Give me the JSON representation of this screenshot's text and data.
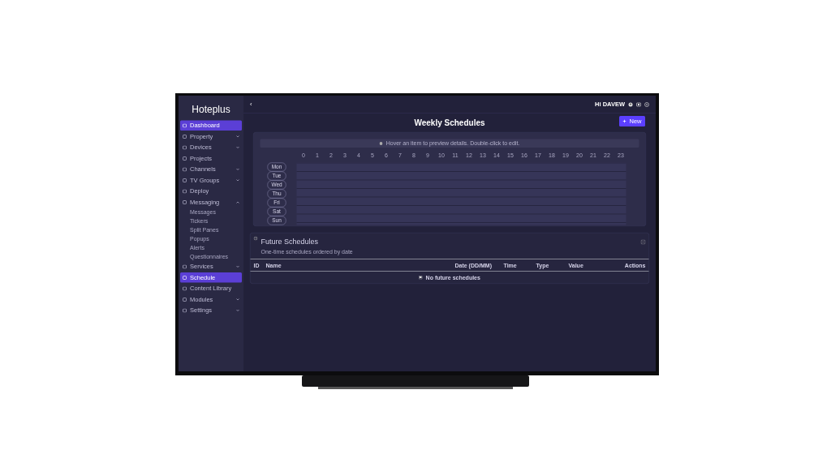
{
  "logo": "Hoteplus",
  "sidebar": {
    "items": [
      {
        "label": "Dashboard",
        "selected": true
      },
      {
        "label": "Property",
        "selected": false,
        "expanded": false
      },
      {
        "label": "Devices",
        "selected": false,
        "expanded": false
      },
      {
        "label": "Projects",
        "selected": false
      },
      {
        "label": "Channels",
        "selected": false,
        "expanded": false
      },
      {
        "label": "TV Groups",
        "selected": false,
        "expanded": false
      },
      {
        "label": "Deploy",
        "selected": false
      },
      {
        "label": "Messaging",
        "selected": false,
        "expanded": true,
        "children": [
          {
            "label": "Messages"
          },
          {
            "label": "Tickers"
          },
          {
            "label": "Split Panes"
          },
          {
            "label": "Popups"
          },
          {
            "label": "Alerts"
          },
          {
            "label": "Questionnaires"
          }
        ]
      },
      {
        "label": "Services",
        "selected": false,
        "expanded": false
      },
      {
        "label": "Schedule",
        "selected": true
      },
      {
        "label": "Content Library",
        "selected": false
      },
      {
        "label": "Modules",
        "selected": false,
        "expanded": false
      },
      {
        "label": "Settings",
        "selected": false,
        "expanded": false
      }
    ]
  },
  "topbar": {
    "back": "‹",
    "greeting": "Hi DAVEW"
  },
  "page": {
    "title": "Weekly Schedules",
    "new_button": "New"
  },
  "weekly": {
    "hint": "Hover an item to preview details. Double-click to edit.",
    "hours": [
      "0",
      "1",
      "2",
      "3",
      "4",
      "5",
      "6",
      "7",
      "8",
      "9",
      "10",
      "11",
      "12",
      "13",
      "14",
      "15",
      "16",
      "17",
      "18",
      "19",
      "20",
      "21",
      "22",
      "23"
    ],
    "days": [
      "Mon",
      "Tue",
      "Wed",
      "Thu",
      "Fri",
      "Sat",
      "Sun"
    ]
  },
  "future": {
    "title": "Future Schedules",
    "subtitle": "One-time schedules ordered by date",
    "columns": [
      "ID",
      "Name",
      "Date (DD/MM)",
      "Time",
      "Type",
      "Value",
      "Actions"
    ],
    "empty": "No future schedules"
  }
}
